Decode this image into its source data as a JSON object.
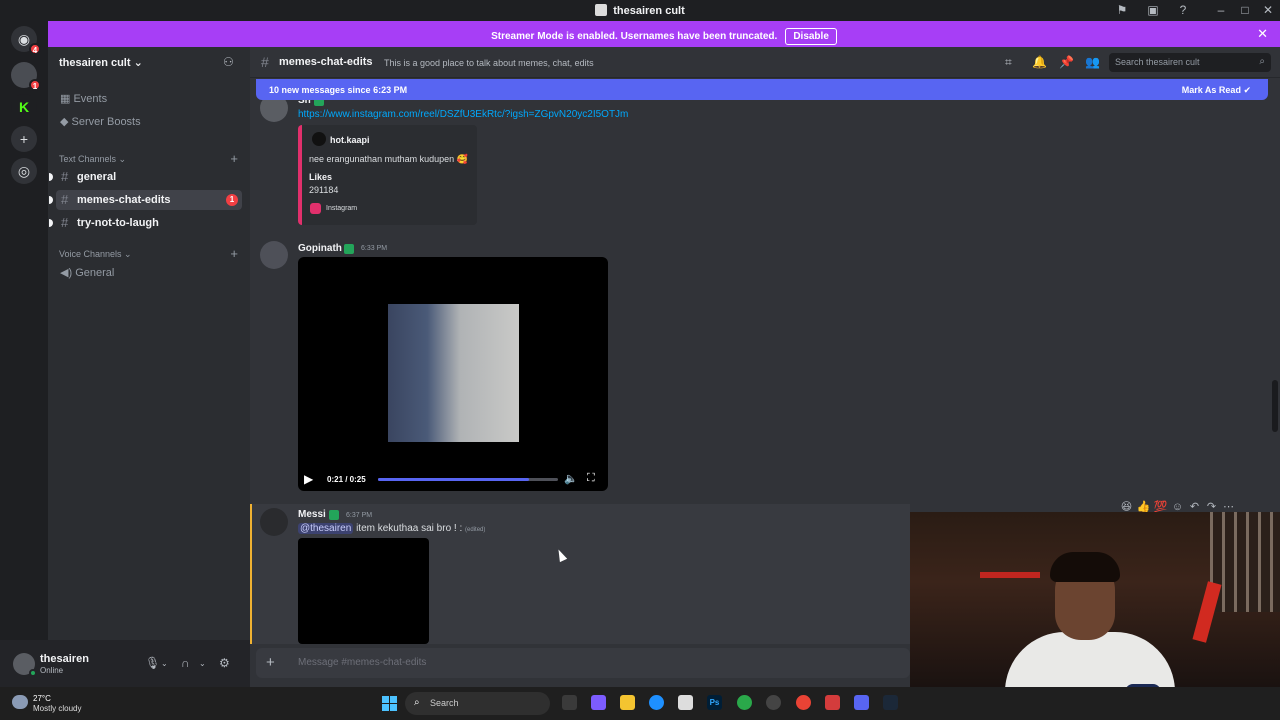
{
  "window": {
    "title": "thesairen cult"
  },
  "banner": {
    "text": "Streamer Mode is enabled. Usernames have been truncated.",
    "disable_label": "Disable",
    "close_icon": "close-icon"
  },
  "rail": {
    "dm_badge": "4",
    "server1_badge": "1"
  },
  "sidebar": {
    "server_name": "thesairen cult",
    "events_label": "Events",
    "boosts_label": "Server Boosts",
    "text_category": "Text Channels",
    "voice_category": "Voice Channels",
    "channels": [
      {
        "name": "general",
        "unread": true,
        "active": false
      },
      {
        "name": "memes-chat-edits",
        "unread": true,
        "active": true,
        "mentions": "1"
      },
      {
        "name": "try-not-to-laugh",
        "unread": true,
        "active": false
      }
    ],
    "voice_channels": [
      {
        "name": "General"
      }
    ]
  },
  "user_panel": {
    "username": "thesairen",
    "status": "Online"
  },
  "chat_header": {
    "channel": "memes-chat-edits",
    "topic": "This is a good place to talk about memes, chat, edits",
    "search_placeholder": "Search thesairen cult"
  },
  "new_messages_bar": {
    "text": "10 new messages since 6:23 PM",
    "action": "Mark As Read"
  },
  "messages": {
    "first": {
      "author": "Sh",
      "link": "https://www.instagram.com/reel/DSZfU3EkRtc/?igsh=ZGpvN20yc2I5OTJm",
      "embed": {
        "author": "hot.kaapi",
        "description": "nee erangunathan mutham kudupen 🥰",
        "field_name": "Likes",
        "field_value": "291184",
        "footer": "Instagram"
      }
    },
    "second": {
      "author": "Gopinath",
      "time": "6:33 PM",
      "video": {
        "time_label": "0:21 / 0:25",
        "progress": 0.84
      }
    },
    "third": {
      "author": "Messi",
      "time": "6:37 PM",
      "mention": "@thesairen",
      "text": "item kekuthaa sai bro ! :",
      "edited": "(edited)"
    }
  },
  "composer": {
    "placeholder": "Message #memes-chat-edits"
  },
  "taskbar": {
    "temperature": "27°C",
    "weather": "Mostly cloudy",
    "search_label": "Search"
  },
  "colors": {
    "accent": "#5865f2",
    "streamer_banner": "#a73ef6",
    "mention_bar": "#f0b232",
    "link": "#00a8fc"
  }
}
